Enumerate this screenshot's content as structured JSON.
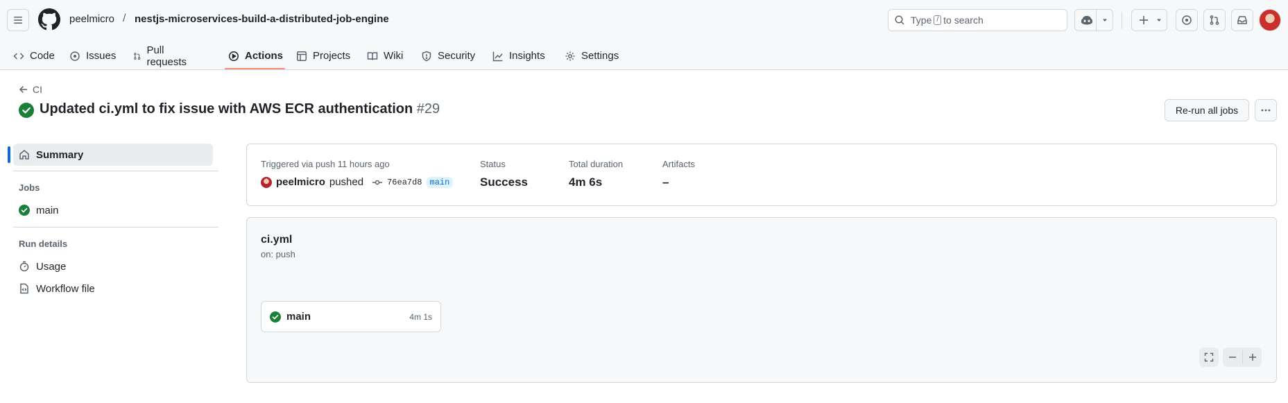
{
  "header": {
    "owner": "peelmicro",
    "separator": "/",
    "repo": "nestjs-microservices-build-a-distributed-job-engine",
    "search_prefix": "Type",
    "search_key": "/",
    "search_suffix": "to search"
  },
  "tabs": [
    {
      "label": "Code",
      "icon": "code-icon"
    },
    {
      "label": "Issues",
      "icon": "issue-icon"
    },
    {
      "label": "Pull requests",
      "icon": "pull-request-icon"
    },
    {
      "label": "Actions",
      "icon": "play-icon",
      "active": true
    },
    {
      "label": "Projects",
      "icon": "table-icon"
    },
    {
      "label": "Wiki",
      "icon": "book-icon"
    },
    {
      "label": "Security",
      "icon": "shield-icon"
    },
    {
      "label": "Insights",
      "icon": "graph-icon"
    },
    {
      "label": "Settings",
      "icon": "gear-icon"
    }
  ],
  "run": {
    "back_label": "CI",
    "title": "Updated ci.yml to fix issue with AWS ECR authentication",
    "number": "#29",
    "rerun_label": "Re-run all jobs"
  },
  "sidebar": {
    "summary_label": "Summary",
    "jobs_heading": "Jobs",
    "jobs": [
      {
        "label": "main",
        "status": "success"
      }
    ],
    "run_details_heading": "Run details",
    "usage_label": "Usage",
    "workflow_file_label": "Workflow file"
  },
  "summary": {
    "trigger_label": "Triggered via push 11 hours ago",
    "actor": "peelmicro",
    "action": "pushed",
    "commit": "76ea7d8",
    "branch": "main",
    "status_label": "Status",
    "status_value": "Success",
    "duration_label": "Total duration",
    "duration_value": "4m 6s",
    "artifacts_label": "Artifacts",
    "artifacts_value": "–"
  },
  "workflow": {
    "file": "ci.yml",
    "trigger": "on: push",
    "job_name": "main",
    "job_duration": "4m 1s"
  },
  "colors": {
    "success": "#1a7f37",
    "accent": "#0969da",
    "tab_underline": "#fd8c73"
  }
}
